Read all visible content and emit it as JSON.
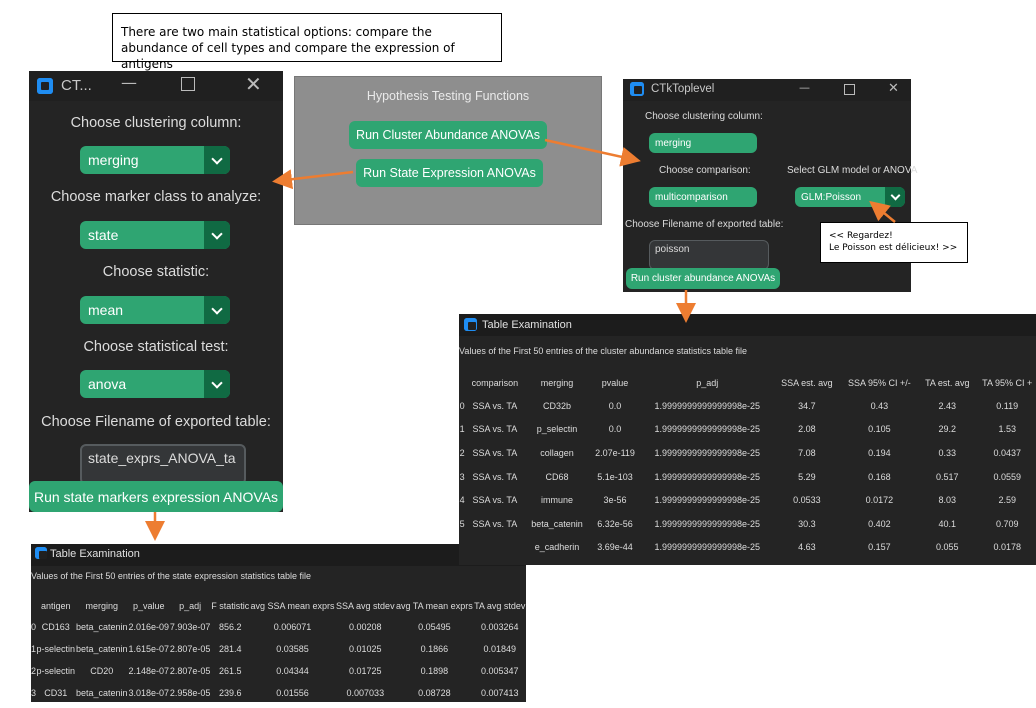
{
  "notes": {
    "top": "There are two main statistical options: compare the abundance of cell types and compare the expression of antigens",
    "poisson_line1": "<< Regardez!",
    "poisson_line2": "Le Poisson est délicieux! >>"
  },
  "left_window": {
    "title": "CT...",
    "clustering_label": "Choose clustering column:",
    "clustering_value": "merging",
    "marker_label": "Choose marker class to analyze:",
    "marker_value": "state",
    "statistic_label": "Choose statistic:",
    "statistic_value": "mean",
    "test_label": "Choose statistical test:",
    "test_value": "anova",
    "filename_label": "Choose Filename of exported table:",
    "filename_value": "state_exprs_ANOVA_ta",
    "run_button": "Run state markers expression ANOVAs"
  },
  "middle_window": {
    "title": "Hypothesis Testing Functions",
    "cluster_button": "Run Cluster Abundance ANOVAs",
    "state_button": "Run State Expression ANOVAs"
  },
  "right_window": {
    "title": "CTkToplevel",
    "clustering_label": "Choose clustering column:",
    "clustering_value": "merging",
    "comparison_label": "Choose comparison:",
    "comparison_value": "multicomparison",
    "glm_label": "Select GLM model or ANOVA",
    "glm_value": "GLM:Poisson",
    "filename_label": "Choose Filename of exported table:",
    "filename_value": "poisson",
    "run_button": "Run cluster abundance ANOVAs"
  },
  "state_table": {
    "title": "Table Examination",
    "subtitle": "Values of the First 50 entries of the state expression statistics table file",
    "columns": [
      "",
      "antigen",
      "merging",
      "p_value",
      "p_adj",
      "F statistic",
      "avg SSA mean exprs",
      "SSA avg stdev",
      "avg TA mean exprs",
      "TA avg stdev"
    ],
    "rows": [
      [
        "0",
        "CD163",
        "beta_catenin",
        "2.016e-09",
        "7.903e-07",
        "856.2",
        "0.006071",
        "0.00208",
        "0.05495",
        "0.003264"
      ],
      [
        "1",
        "p-selectin",
        "beta_catenin",
        "1.615e-07",
        "2.807e-05",
        "281.4",
        "0.03585",
        "0.01025",
        "0.1866",
        "0.01849"
      ],
      [
        "2",
        "p-selectin",
        "CD20",
        "2.148e-07",
        "2.807e-05",
        "261.5",
        "0.04344",
        "0.01725",
        "0.1898",
        "0.005347"
      ],
      [
        "3",
        "CD31",
        "beta_catenin",
        "3.018e-07",
        "2.958e-05",
        "239.6",
        "0.01556",
        "0.007033",
        "0.08728",
        "0.007413"
      ]
    ]
  },
  "cluster_table": {
    "title": "Table Examination",
    "subtitle": "Values of the First 50 entries of the cluster abundance statistics table file",
    "columns": [
      "",
      "comparison",
      "merging",
      "pvalue",
      "p_adj",
      "SSA est. avg",
      "SSA 95% CI +/-",
      "TA est. avg",
      "TA 95% CI +"
    ],
    "rows": [
      [
        "0",
        "SSA vs. TA",
        "CD32b",
        "0.0",
        "1.9999999999999998e-25",
        "34.7",
        "0.43",
        "2.43",
        "0.119"
      ],
      [
        "1",
        "SSA vs. TA",
        "p_selectin",
        "0.0",
        "1.9999999999999998e-25",
        "2.08",
        "0.105",
        "29.2",
        "1.53"
      ],
      [
        "2",
        "SSA vs. TA",
        "collagen",
        "2.07e-119",
        "1.9999999999999998e-25",
        "7.08",
        "0.194",
        "0.33",
        "0.0437"
      ],
      [
        "3",
        "SSA vs. TA",
        "CD68",
        "5.1e-103",
        "1.9999999999999998e-25",
        "5.29",
        "0.168",
        "0.517",
        "0.0559"
      ],
      [
        "4",
        "SSA vs. TA",
        "immune",
        "3e-56",
        "1.9999999999999998e-25",
        "0.0533",
        "0.0172",
        "8.03",
        "2.59"
      ],
      [
        "5",
        "SSA vs. TA",
        "beta_catenin",
        "6.32e-56",
        "1.9999999999999998e-25",
        "30.3",
        "0.402",
        "40.1",
        "0.709"
      ],
      [
        "",
        "",
        "e_cadherin",
        "3.69e-44",
        "1.9999999999999998e-25",
        "4.63",
        "0.157",
        "0.055",
        "0.0178"
      ]
    ]
  },
  "colors": {
    "accent_green": "#2fa572",
    "dark_green": "#106a43",
    "arrow_orange": "#ed7d31",
    "ctk_blue": "#1f8df2"
  }
}
